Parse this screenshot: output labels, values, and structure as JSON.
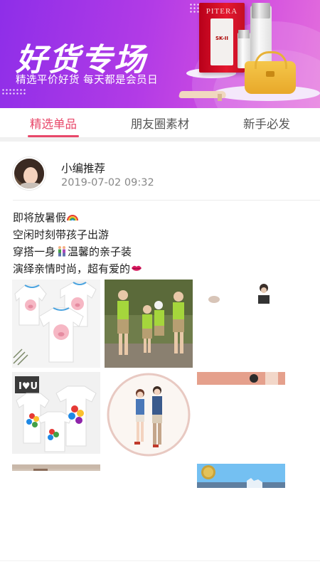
{
  "banner": {
    "title": "好货专场",
    "subtitle": "精选平价好货 每天都是会员日",
    "product_brand": "PITERA",
    "product_label": "SK-II"
  },
  "tabs": [
    {
      "label": "精选单品",
      "active": true
    },
    {
      "label": "朋友圈素材",
      "active": false
    },
    {
      "label": "新手必发",
      "active": false
    }
  ],
  "post": {
    "author": "小编推荐",
    "time": "2019-07-02 09:32",
    "lines": [
      {
        "text": "即将放暑假",
        "emoji": "rainbow-icon"
      },
      {
        "text": "空闲时刻带孩子出游",
        "emoji": ""
      },
      {
        "text": "穿搭一身",
        "emoji": "couple-icon",
        "text_after": "温馨的亲子装"
      },
      {
        "text": "演绎亲情时尚，超有爱的",
        "emoji": "lips-icon"
      }
    ],
    "images": [
      "pig-print-tshirts",
      "family-green-outfits",
      "small-portrait-thumbnails",
      "rainbow-hands-tshirts",
      "illustrated-couple-circle",
      "partial-photo-strip",
      "partial-photo-strip",
      "partial-scenery-photo"
    ]
  },
  "colors": {
    "accent": "#e8486a",
    "banner_start": "#8e2ee8",
    "banner_end": "#e46fdc"
  }
}
